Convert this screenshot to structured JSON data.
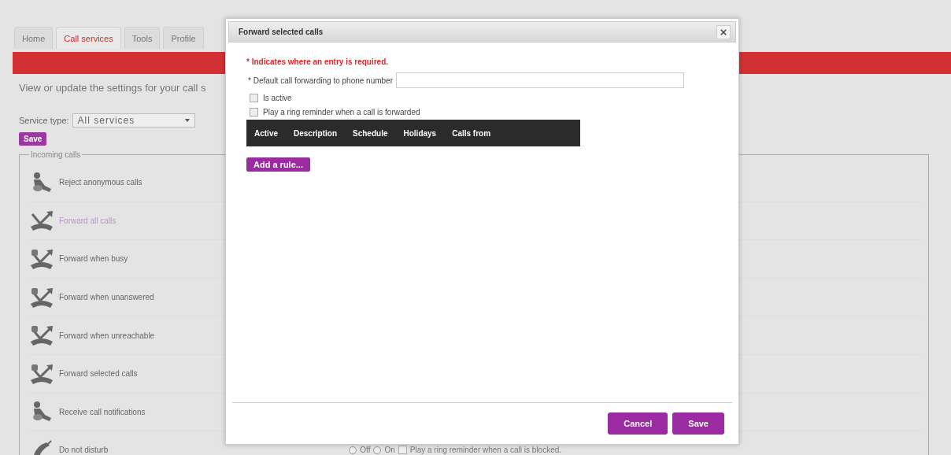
{
  "tabs": [
    {
      "label": "Home",
      "selected": false
    },
    {
      "label": "Call services",
      "selected": true
    },
    {
      "label": "Tools",
      "selected": false
    },
    {
      "label": "Profile",
      "selected": false
    }
  ],
  "intro": "View or update the settings for your call s",
  "service_type": {
    "label": "Service type:",
    "value": "All services"
  },
  "save_button": "Save",
  "incoming": {
    "legend": "Incoming calls",
    "rows": [
      {
        "label": "Reject anonymous calls",
        "selected": false
      },
      {
        "label": "Forward all calls",
        "selected": true
      },
      {
        "label": "Forward when busy",
        "selected": false
      },
      {
        "label": "Forward when unanswered",
        "selected": false
      },
      {
        "label": "Forward when unreachable",
        "selected": false
      },
      {
        "label": "Forward selected calls",
        "selected": false
      },
      {
        "label": "Receive call notifications",
        "selected": false
      },
      {
        "label": "Do not disturb",
        "selected": false,
        "options": [
          {
            "label": "Off",
            "selected": false
          },
          {
            "label": "On",
            "selected": false
          }
        ],
        "reminder": {
          "label": "Play a ring reminder when a call is blocked.",
          "checked": false
        }
      }
    ]
  },
  "dialog": {
    "title": "Forward selected calls",
    "required_note": "* Indicates where an entry is required.",
    "phone_label": "* Default call forwarding to phone number",
    "checks": [
      {
        "label": "Is active",
        "checked": false
      },
      {
        "label": "Play a ring reminder when a call is forwarded",
        "checked": false
      }
    ],
    "table": {
      "columns": [
        "Active",
        "Description",
        "Schedule",
        "Holidays",
        "Calls from"
      ]
    },
    "add_rule": "Add a rule...",
    "buttons": [
      "Cancel",
      "Save"
    ]
  }
}
